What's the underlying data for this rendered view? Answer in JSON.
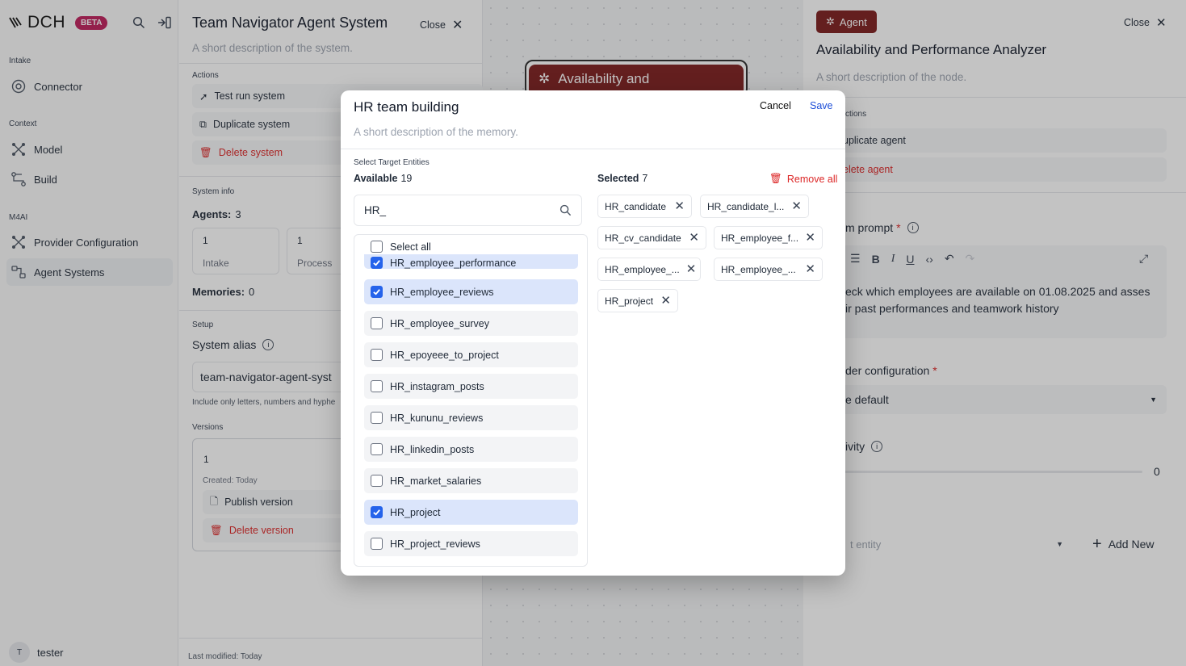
{
  "sidebar": {
    "logo": "DCH",
    "beta": "BETA",
    "sections": {
      "intake": "Intake",
      "context": "Context",
      "m4ai": "M4AI"
    },
    "items": [
      {
        "label": "Connector",
        "icon": "connector-icon"
      },
      {
        "label": "Model",
        "icon": "model-icon"
      },
      {
        "label": "Build",
        "icon": "build-icon"
      },
      {
        "label": "Provider Configuration",
        "icon": "provider-icon"
      },
      {
        "label": "Agent Systems",
        "icon": "agent-systems-icon"
      }
    ],
    "user": {
      "initial": "T",
      "name": "tester"
    }
  },
  "system_panel": {
    "title": "Team Navigator Agent System",
    "close": "Close",
    "description": "A short description of the system.",
    "actions_label": "Actions",
    "actions": [
      "Test run system",
      "Duplicate system",
      "Delete system"
    ],
    "system_info_label": "System info",
    "agents_label": "Agents:",
    "agents_count": "3",
    "stats": [
      {
        "value": "1",
        "label": "Intake"
      },
      {
        "value": "1",
        "label": "Process"
      }
    ],
    "memories_label": "Memories:",
    "memories_count": "0",
    "setup_label": "Setup",
    "system_alias_label": "System alias",
    "system_alias_value": "team-navigator-agent-syst",
    "alias_hint": "Include only letters, numbers and hyphe",
    "versions_label": "Versions",
    "version_number": "1",
    "version_created": "Created: Today",
    "publish_version": "Publish version",
    "delete_version": "Delete version",
    "last_modified": "Last modified: Today"
  },
  "canvas": {
    "node_title": "Availability and"
  },
  "agent_panel": {
    "badge": "Agent",
    "close": "Close",
    "title": "Availability and Performance Analyzer",
    "description": "A short description of the node.",
    "actions_label": "ctions",
    "duplicate_agent": "uplicate agent",
    "delete_agent": "elete agent",
    "prompt_label": "m prompt",
    "prompt_required": "*",
    "prompt_text": "eck which employees are available on 01.08.2025 and asses\nir past performances and teamwork history",
    "provider_label": "der configuration",
    "provider_required": "*",
    "provider_value": "e default",
    "creativity_label": "ivity",
    "creativity_value": "0",
    "entity_placeholder": "t entity",
    "add_new": "Add New"
  },
  "modal": {
    "title": "HR team building",
    "description": "A short description of the memory.",
    "cancel": "Cancel",
    "save": "Save",
    "section_label": "Select Target Entities",
    "available_label": "Available",
    "available_count": "19",
    "selected_label": "Selected",
    "selected_count": "7",
    "remove_all": "Remove all",
    "search_value": "HR_",
    "select_all": "Select all",
    "options": [
      {
        "label": "HR_employee_performance",
        "checked": true
      },
      {
        "label": "HR_employee_reviews",
        "checked": true
      },
      {
        "label": "HR_employee_survey",
        "checked": false
      },
      {
        "label": "HR_epoyeee_to_project",
        "checked": false
      },
      {
        "label": "HR_instagram_posts",
        "checked": false
      },
      {
        "label": "HR_kununu_reviews",
        "checked": false
      },
      {
        "label": "HR_linkedin_posts",
        "checked": false
      },
      {
        "label": "HR_market_salaries",
        "checked": false
      },
      {
        "label": "HR_project",
        "checked": true
      },
      {
        "label": "HR_project_reviews",
        "checked": false
      }
    ],
    "selected": [
      "HR_candidate",
      "HR_candidate_l...",
      "HR_cv_candidate",
      "HR_employee_f...",
      "HR_employee_...",
      "HR_employee_...",
      "HR_project"
    ]
  },
  "colors": {
    "accent": "#2563eb",
    "brand": "#7c1d1d",
    "beta": "#be1e5a",
    "danger": "#dc2626"
  }
}
